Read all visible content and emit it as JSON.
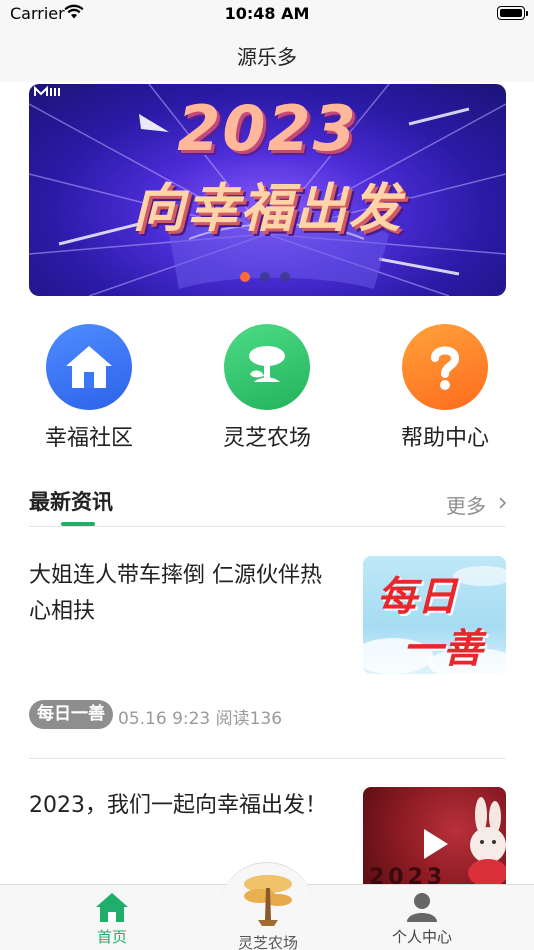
{
  "status_bar": {
    "carrier": "Carrier",
    "time": "10:48 AM"
  },
  "nav": {
    "title": "源乐多"
  },
  "banner": {
    "year": "2023",
    "slogan": "向幸福出发",
    "logo_mark": "m",
    "indicators": [
      true,
      false,
      false
    ]
  },
  "quick_entries": [
    {
      "label": "幸福社区",
      "icon": "home-icon",
      "color": "#3a78f5"
    },
    {
      "label": "灵芝农场",
      "icon": "sprout-icon",
      "color": "#2fc46d"
    },
    {
      "label": "帮助中心",
      "icon": "question-icon",
      "color": "#ff8a2a"
    }
  ],
  "news_section": {
    "title": "最新资讯",
    "more": "更多"
  },
  "news": [
    {
      "title": "大姐连人带车摔倒 仁源伙伴热心相扶",
      "thumb_text_1": "每日",
      "thumb_text_2": "一善",
      "tag": "每日一善",
      "meta": "05.16 9:23 阅读136"
    },
    {
      "title": "2023，我们一起向幸福出发！",
      "thumb_label": "2023",
      "thumb_icon": "play-icon"
    }
  ],
  "tab_bar": {
    "items": [
      {
        "label": "首页",
        "icon": "home-tab-icon",
        "active": true
      },
      {
        "label": "灵芝农场",
        "icon": "ganoderma-tree-icon",
        "active": false
      },
      {
        "label": "个人中心",
        "icon": "person-icon",
        "active": false
      }
    ]
  },
  "colors": {
    "accent": "#1fae6b",
    "tag_bg": "#8e8e8e",
    "muted": "#9a9a9a"
  }
}
